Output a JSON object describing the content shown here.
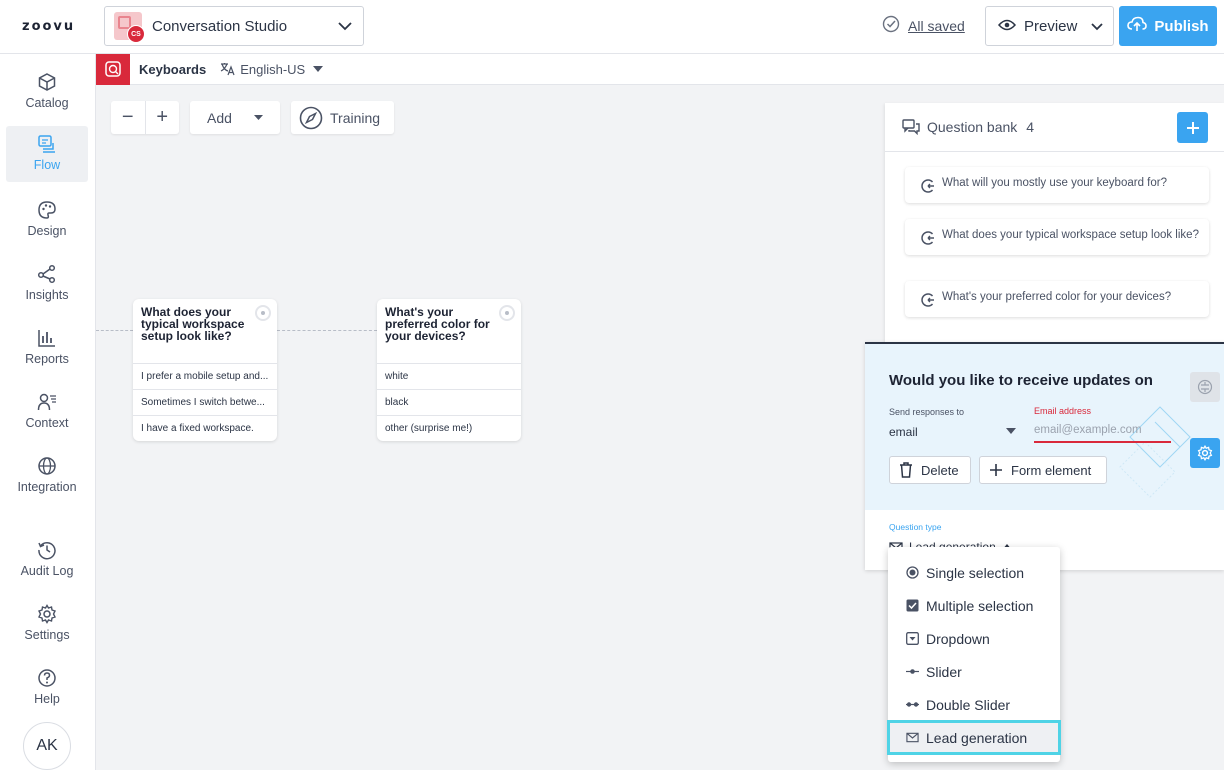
{
  "brand": {
    "logo": "zoovu"
  },
  "app_select": {
    "badge": "CS",
    "name": "Conversation Studio"
  },
  "header": {
    "saved_text": "All saved",
    "preview_label": "Preview",
    "publish_label": "Publish"
  },
  "sidebar": {
    "items": [
      {
        "label": "Catalog",
        "icon": "cube-icon",
        "active": false
      },
      {
        "label": "Flow",
        "icon": "flow-icon",
        "active": true
      },
      {
        "label": "Design",
        "icon": "palette-icon",
        "active": false
      },
      {
        "label": "Insights",
        "icon": "share-nodes-icon",
        "active": false
      },
      {
        "label": "Reports",
        "icon": "bar-chart-icon",
        "active": false
      },
      {
        "label": "Context",
        "icon": "context-icon",
        "active": false
      },
      {
        "label": "Integration",
        "icon": "globe-icon",
        "active": false
      },
      {
        "label": "Audit Log",
        "icon": "history-icon",
        "active": false
      },
      {
        "label": "Settings",
        "icon": "gear-icon",
        "active": false
      },
      {
        "label": "Help",
        "icon": "help-icon",
        "active": false
      }
    ],
    "avatar": "AK"
  },
  "subheader": {
    "title": "Keyboards",
    "language": "English-US"
  },
  "toolbar": {
    "zoom_out": "−",
    "zoom_in": "+",
    "add_label": "Add",
    "training_label": "Training"
  },
  "flow_nodes": [
    {
      "title": "What does your typical workspace setup look like?",
      "options": [
        "I prefer a mobile setup and...",
        "Sometimes I switch betwe...",
        "I have a fixed workspace."
      ]
    },
    {
      "title": "What's your preferred color for your devices?",
      "options": [
        "white",
        "black",
        "other (surprise me!)"
      ]
    }
  ],
  "question_bank": {
    "title": "Question bank",
    "count": "4",
    "questions": [
      "What will you mostly use your keyboard for?",
      "What does your typical workspace setup look like?",
      "What's your preferred color for your devices?"
    ]
  },
  "editor": {
    "title": "Would you like to receive updates on",
    "send_label": "Send responses to",
    "send_value": "email",
    "email_label": "Email address",
    "email_placeholder": "email@example.com",
    "delete_label": "Delete",
    "form_element_label": "Form element",
    "question_type_label": "Question type",
    "question_type_value": "Lead generation"
  },
  "question_type_menu": {
    "items": [
      {
        "label": "Single selection",
        "icon": "radio-icon"
      },
      {
        "label": "Multiple selection",
        "icon": "checkbox-icon"
      },
      {
        "label": "Dropdown",
        "icon": "dropdown-icon"
      },
      {
        "label": "Slider",
        "icon": "slider-icon"
      },
      {
        "label": "Double Slider",
        "icon": "double-slider-icon"
      },
      {
        "label": "Lead generation",
        "icon": "mail-icon"
      }
    ],
    "selected": "Lead generation"
  },
  "colors": {
    "accent": "#3aa4f0",
    "brand_red": "#d9293b",
    "highlight": "#4fd3e6"
  }
}
